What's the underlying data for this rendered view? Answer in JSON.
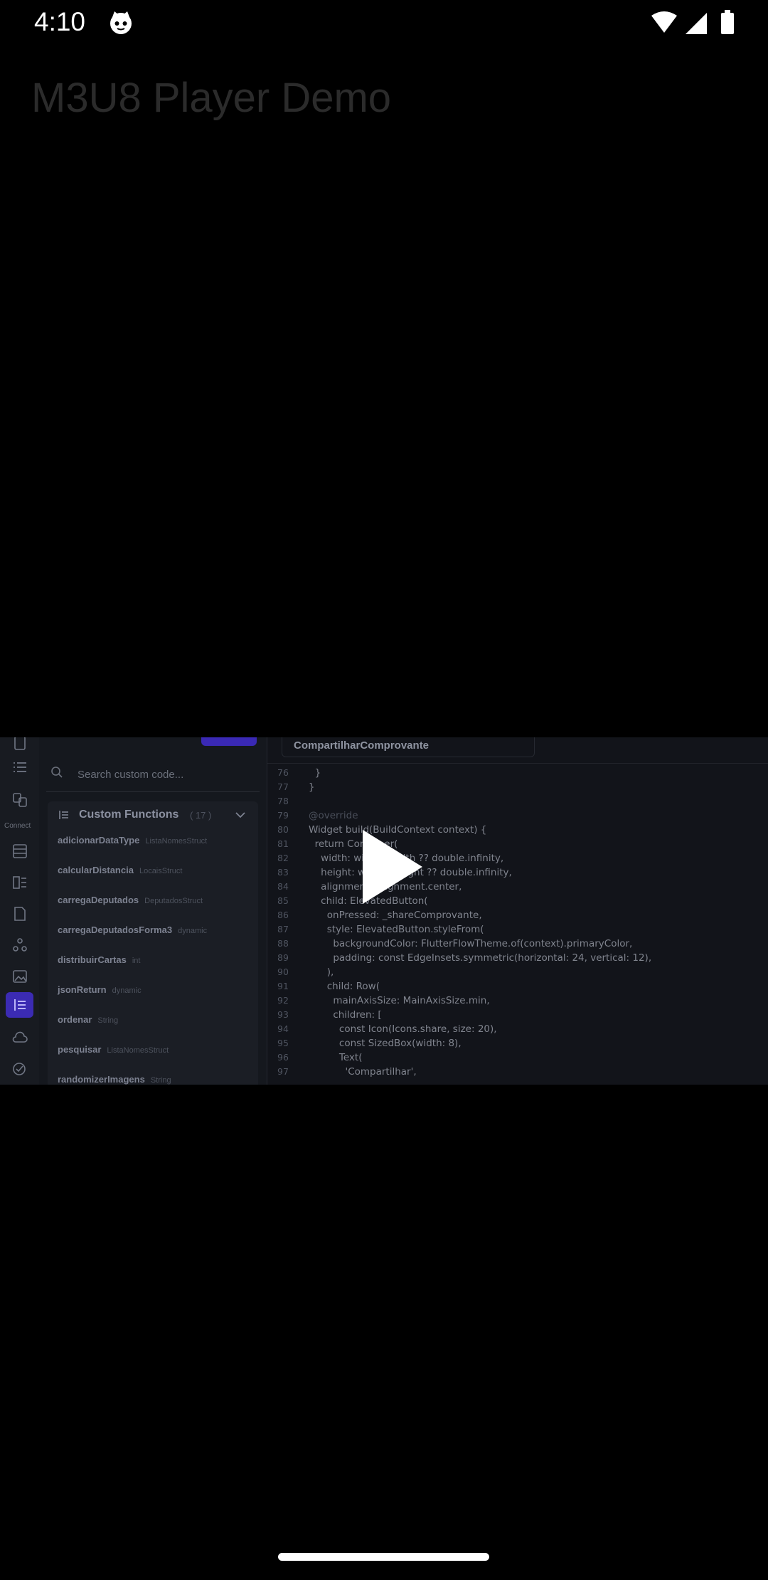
{
  "status": {
    "time": "4:10"
  },
  "app": {
    "title": "M3U8 Player Demo"
  },
  "video": {
    "rail": {
      "connect_label": "Connect"
    },
    "search": {
      "placeholder": "Search custom code..."
    },
    "panel": {
      "title": "Custom Functions",
      "count": "( 17 )",
      "functions": [
        {
          "name": "adicionarDataType",
          "type": "ListaNomesStruct"
        },
        {
          "name": "calcularDistancia",
          "type": "LocaisStruct"
        },
        {
          "name": "carregaDeputados",
          "type": "DeputadosStruct"
        },
        {
          "name": "carregaDeputadosForma3",
          "type": "dynamic"
        },
        {
          "name": "distribuirCartas",
          "type": "int"
        },
        {
          "name": "jsonReturn",
          "type": "dynamic"
        },
        {
          "name": "ordenar",
          "type": "String"
        },
        {
          "name": "pesquisar",
          "type": "ListaNomesStruct"
        },
        {
          "name": "randomizerImagens",
          "type": "String"
        }
      ]
    },
    "editor": {
      "tab_label": "CompartilharComprovante",
      "lines": [
        {
          "n": "76",
          "c": "  }"
        },
        {
          "n": "77",
          "c": "}"
        },
        {
          "n": "78",
          "c": ""
        },
        {
          "n": "79",
          "c": "@override"
        },
        {
          "n": "80",
          "c": "Widget build(BuildContext context) {"
        },
        {
          "n": "81",
          "c": "  return Container("
        },
        {
          "n": "82",
          "c": "    width: widget.width ?? double.infinity,"
        },
        {
          "n": "83",
          "c": "    height: widget.height ?? double.infinity,"
        },
        {
          "n": "84",
          "c": "    alignment: Alignment.center,"
        },
        {
          "n": "85",
          "c": "    child: ElevatedButton("
        },
        {
          "n": "86",
          "c": "      onPressed: _shareComprovante,"
        },
        {
          "n": "87",
          "c": "      style: ElevatedButton.styleFrom("
        },
        {
          "n": "88",
          "c": "        backgroundColor: FlutterFlowTheme.of(context).primaryColor,"
        },
        {
          "n": "89",
          "c": "        padding: const EdgeInsets.symmetric(horizontal: 24, vertical: 12),"
        },
        {
          "n": "90",
          "c": "      ),"
        },
        {
          "n": "91",
          "c": "      child: Row("
        },
        {
          "n": "92",
          "c": "        mainAxisSize: MainAxisSize.min,"
        },
        {
          "n": "93",
          "c": "        children: ["
        },
        {
          "n": "94",
          "c": "          const Icon(Icons.share, size: 20),"
        },
        {
          "n": "95",
          "c": "          const SizedBox(width: 8),"
        },
        {
          "n": "96",
          "c": "          Text("
        },
        {
          "n": "97",
          "c": "            'Compartilhar',"
        }
      ]
    }
  },
  "colors": {
    "background": "#000000",
    "title": "#2b2b2b",
    "accent": "#3b2bb3"
  }
}
